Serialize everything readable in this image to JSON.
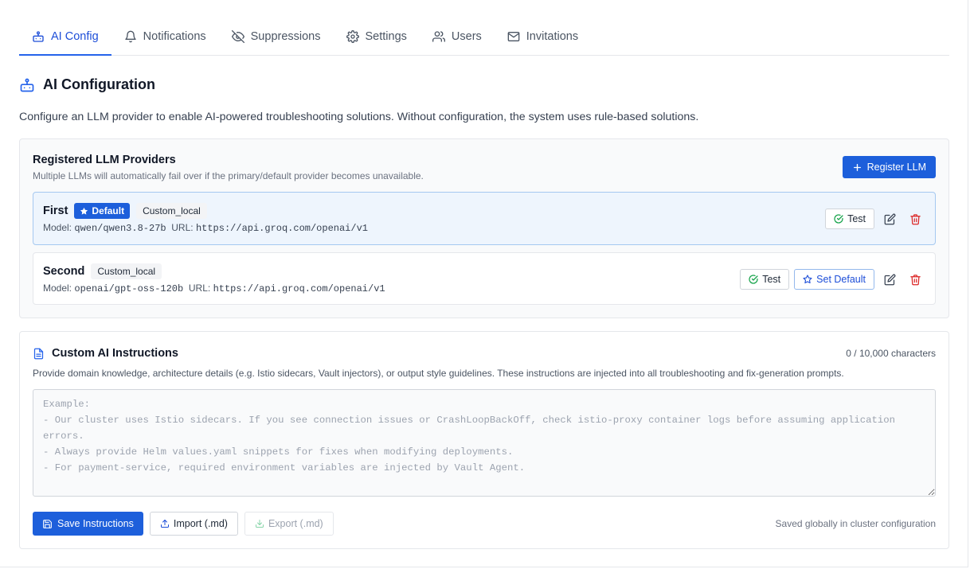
{
  "tabs": [
    {
      "label": "AI Config",
      "icon": "robot-icon",
      "active": true
    },
    {
      "label": "Notifications",
      "icon": "bell-icon"
    },
    {
      "label": "Suppressions",
      "icon": "eye-off-icon"
    },
    {
      "label": "Settings",
      "icon": "gear-icon"
    },
    {
      "label": "Users",
      "icon": "users-icon"
    },
    {
      "label": "Invitations",
      "icon": "mail-icon"
    }
  ],
  "page": {
    "title": "AI Configuration",
    "intro": "Configure an LLM provider to enable AI-powered troubleshooting solutions. Without configuration, the system uses rule-based solutions."
  },
  "providers_panel": {
    "title": "Registered LLM Providers",
    "subtitle": "Multiple LLMs will automatically fail over if the primary/default provider becomes unavailable.",
    "register_label": "Register LLM",
    "model_label": "Model:",
    "url_label": "URL:",
    "default_badge": "Default",
    "test_label": "Test",
    "set_default_label": "Set Default",
    "providers": [
      {
        "name": "First",
        "type": "Custom_local",
        "model": "qwen/qwen3.8-27b",
        "url": "https://api.groq.com/openai/v1"
      },
      {
        "name": "Second",
        "type": "Custom_local",
        "model": "openai/gpt-oss-120b",
        "url": "https://api.groq.com/openai/v1"
      }
    ]
  },
  "instructions": {
    "title": "Custom AI Instructions",
    "char_count": "0 / 10,000 characters",
    "description": "Provide domain knowledge, architecture details (e.g. Istio sidecars, Vault injectors), or output style guidelines. These instructions are injected into all troubleshooting and fix-generation prompts.",
    "placeholder": "Example:\n- Our cluster uses Istio sidecars. If you see connection issues or CrashLoopBackOff, check istio-proxy container logs before assuming application errors.\n- Always provide Helm values.yaml snippets for fixes when modifying deployments.\n- For payment-service, required environment variables are injected by Vault Agent.",
    "value": "",
    "save_label": "Save Instructions",
    "import_label": "Import (.md)",
    "export_label": "Export (.md)",
    "saved_note": "Saved globally in cluster configuration"
  },
  "colors": {
    "accent": "#1d5fdb",
    "danger": "#dc2626",
    "success": "#16a34a"
  }
}
